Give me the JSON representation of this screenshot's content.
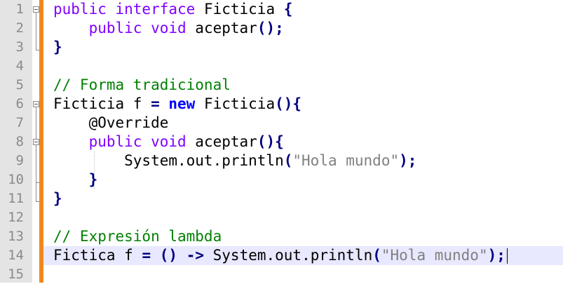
{
  "editor": {
    "line_numbers": [
      "1",
      "2",
      "3",
      "4",
      "5",
      "6",
      "7",
      "8",
      "9",
      "10",
      "11",
      "12",
      "13",
      "14",
      "15"
    ],
    "lines": [
      {
        "tokens": [
          {
            "t": "public interface",
            "c": "kw"
          },
          {
            "t": " Ficticia ",
            "c": ""
          },
          {
            "t": "{",
            "c": "op"
          }
        ]
      },
      {
        "tokens": [
          {
            "t": "    public void",
            "c": "kw"
          },
          {
            "t": " aceptar",
            "c": ""
          },
          {
            "t": "();",
            "c": "op"
          }
        ]
      },
      {
        "tokens": [
          {
            "t": "}",
            "c": "op"
          }
        ]
      },
      {
        "tokens": []
      },
      {
        "tokens": [
          {
            "t": "// Forma tradicional",
            "c": "cm"
          }
        ]
      },
      {
        "tokens": [
          {
            "t": "Ficticia f ",
            "c": ""
          },
          {
            "t": "=",
            "c": "op"
          },
          {
            "t": " ",
            "c": ""
          },
          {
            "t": "new",
            "c": "kwb"
          },
          {
            "t": " Ficticia",
            "c": ""
          },
          {
            "t": "(){",
            "c": "op"
          }
        ]
      },
      {
        "tokens": [
          {
            "t": "    @Override",
            "c": ""
          }
        ]
      },
      {
        "tokens": [
          {
            "t": "    public void",
            "c": "kw"
          },
          {
            "t": " aceptar",
            "c": ""
          },
          {
            "t": "(){",
            "c": "op"
          }
        ]
      },
      {
        "tokens": [
          {
            "t": "        System.out.println",
            "c": ""
          },
          {
            "t": "(",
            "c": "op"
          },
          {
            "t": "\"Hola mundo\"",
            "c": "st"
          },
          {
            "t": ");",
            "c": "op"
          }
        ]
      },
      {
        "tokens": [
          {
            "t": "    }",
            "c": "op"
          }
        ]
      },
      {
        "tokens": [
          {
            "t": "}",
            "c": "op"
          }
        ]
      },
      {
        "tokens": []
      },
      {
        "tokens": [
          {
            "t": "// Expresión lambda",
            "c": "cm"
          }
        ]
      },
      {
        "tokens": [
          {
            "t": "Fictica f ",
            "c": ""
          },
          {
            "t": "=",
            "c": "op"
          },
          {
            "t": " ",
            "c": ""
          },
          {
            "t": "()",
            "c": "op"
          },
          {
            "t": " ",
            "c": ""
          },
          {
            "t": "->",
            "c": "op"
          },
          {
            "t": " System.out.println",
            "c": ""
          },
          {
            "t": "(",
            "c": "op"
          },
          {
            "t": "\"Hola mundo\"",
            "c": "st"
          },
          {
            "t": ");",
            "c": "op"
          }
        ],
        "current": true
      },
      {
        "tokens": []
      }
    ],
    "colors": {
      "keyword": "#8000ff",
      "keyword_bold": "#0000ff",
      "operator": "#000080",
      "comment": "#008000",
      "string": "#808080",
      "change_bar": "#f0891c",
      "current_line": "#e8e8ff"
    }
  }
}
